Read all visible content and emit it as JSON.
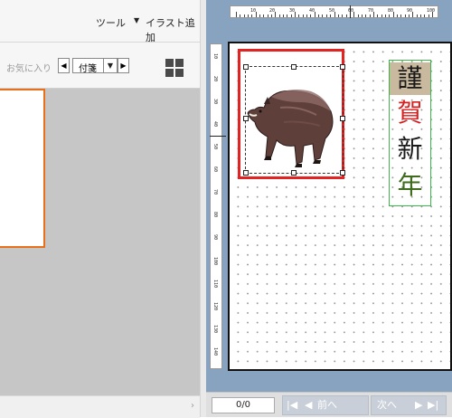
{
  "menu": {
    "tool_label": "ツール",
    "arrow_icon": "▼",
    "add_illust_label": "イラスト追加"
  },
  "favorites": {
    "label": "お気に入り",
    "prev_icon": "◀",
    "next_icon": "▶",
    "dropdown_icon": "▼",
    "selected_value": "付箋"
  },
  "left_scroll": {
    "chevron": "›"
  },
  "ruler": {
    "top_labels": [
      "10",
      "20",
      "30",
      "40",
      "50",
      "60",
      "70",
      "80",
      "90",
      "100"
    ],
    "left_labels": [
      "10",
      "20",
      "30",
      "40",
      "50",
      "60",
      "70",
      "80",
      "90",
      "100",
      "110",
      "120",
      "130",
      "140"
    ]
  },
  "card": {
    "characters": [
      {
        "text": "謹",
        "color": "#1a1a1a",
        "bg": "#c9b99e"
      },
      {
        "text": "賀",
        "color": "#d81e1e",
        "bg": ""
      },
      {
        "text": "新",
        "color": "#1a1a1a",
        "bg": ""
      },
      {
        "text": "年",
        "color": "#3f6b1d",
        "bg": ""
      }
    ],
    "photo_frame_color": "#e32222",
    "text_frame_color": "#3cb84a"
  },
  "footer": {
    "page_indicator": "0/0",
    "first_icon": "|◀",
    "prev_icon": "◀",
    "prev_label": "前へ",
    "next_label": "次へ",
    "next_icon": "▶",
    "last_icon": "▶|"
  }
}
